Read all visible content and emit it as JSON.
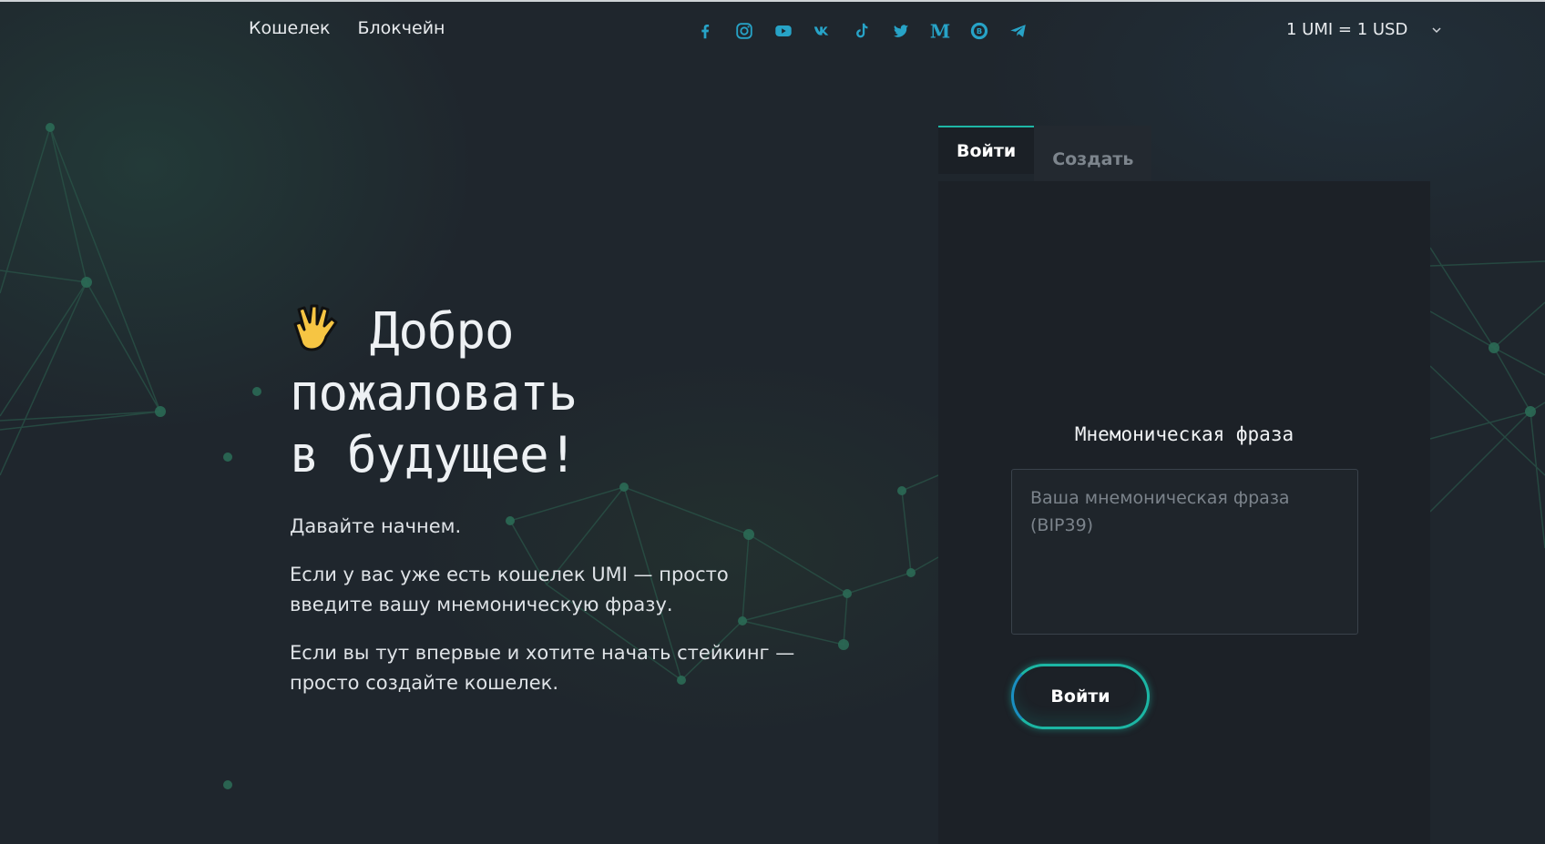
{
  "header": {
    "nav": [
      {
        "label": "Кошелек"
      },
      {
        "label": "Блокчейн"
      }
    ],
    "social_icons": [
      "facebook-icon",
      "instagram-icon",
      "youtube-icon",
      "vk-icon",
      "tiktok-icon",
      "twitter-icon",
      "medium-icon",
      "bitcointalk-icon",
      "telegram-icon"
    ],
    "rate": "1 UMI = 1 USD"
  },
  "hero": {
    "title_line1": "Добро",
    "title_line2": "пожаловать",
    "title_line3": "в будущее!",
    "p1": "Давайте начнем.",
    "p2": "Если у вас уже есть кошелек UMI — просто введите вашу мнемоническую фразу.",
    "p3": "Если вы тут впервые и хотите начать стейкинг — просто создайте кошелек."
  },
  "auth": {
    "tabs": [
      {
        "label": "Войти",
        "active": true
      },
      {
        "label": "Создать",
        "active": false
      }
    ],
    "phrase_label": "Мнемоническая фраза",
    "phrase_placeholder": "Ваша мнемоническая фраза (BIP39)",
    "phrase_value": "",
    "submit_label": "Войти"
  },
  "colors": {
    "accent": "#1eb7a6",
    "accent_alt": "#1a8fc2",
    "icon": "#27a3c7",
    "background": "#1f262d"
  }
}
